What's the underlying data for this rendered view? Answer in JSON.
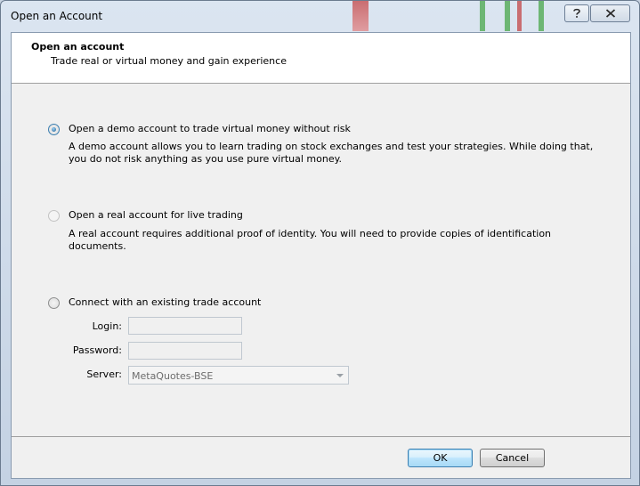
{
  "window": {
    "title": "Open an Account"
  },
  "header": {
    "title": "Open an account",
    "subtitle": "Trade real or virtual money and gain experience"
  },
  "options": {
    "demo": {
      "label": "Open a demo account to trade virtual money without risk",
      "description": "A demo account allows you to learn trading on stock exchanges and test your strategies. While doing that, you do not risk anything as you use pure virtual money.",
      "selected": true
    },
    "real": {
      "label": "Open a real account for live trading",
      "description": "A real account requires additional proof of identity. You will need to provide copies of identification documents.",
      "selected": false
    },
    "existing": {
      "label": "Connect with an existing trade account",
      "selected": false
    }
  },
  "login_form": {
    "login_label": "Login:",
    "login_value": "",
    "password_label": "Password:",
    "password_value": "",
    "server_label": "Server:",
    "server_value": "MetaQuotes-BSE"
  },
  "buttons": {
    "ok": "OK",
    "cancel": "Cancel"
  },
  "icons": {
    "help": "help-icon",
    "close": "close-icon",
    "dropdown": "chevron-down-icon"
  },
  "colors": {
    "header_bg": "#ffffff",
    "client_bg": "#f0f0f0",
    "frame": "#c4d2e3",
    "radio_accent": "#1c5e91"
  }
}
